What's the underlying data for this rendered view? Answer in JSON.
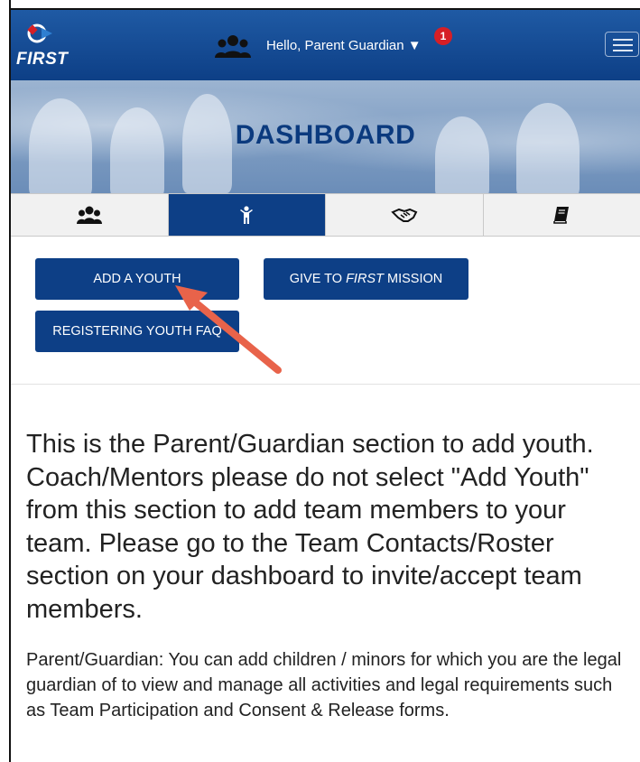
{
  "nav": {
    "logo_text": "FIRST",
    "greeting": "Hello, Parent Guardian ▼",
    "notification_count": "1"
  },
  "banner": {
    "title": "DASHBOARD"
  },
  "tabs": [
    {
      "icon": "users-icon",
      "active": false
    },
    {
      "icon": "youth-icon",
      "active": true
    },
    {
      "icon": "handshake-icon",
      "active": false
    },
    {
      "icon": "book-icon",
      "active": false
    }
  ],
  "buttons": {
    "add_youth": "ADD A YOUTH",
    "give_prefix": "GIVE TO ",
    "give_em": "FIRST",
    "give_suffix": " MISSION",
    "faq": "REGISTERING YOUTH FAQ"
  },
  "notice": "This is the Parent/Guardian section to add youth. Coach/Mentors please do not select \"Add Youth\" from this section to add team members to your team. Please go to the Team Contacts/Roster section on your dashboard to invite/accept team members.",
  "description": "Parent/Guardian: You can add children / minors for which you are the legal guardian of to view and manage all activities and legal requirements such as Team Participation and Consent & Release forms.",
  "colors": {
    "primary": "#0d3f86",
    "badge": "#d61f26",
    "arrow": "#e8634a"
  }
}
